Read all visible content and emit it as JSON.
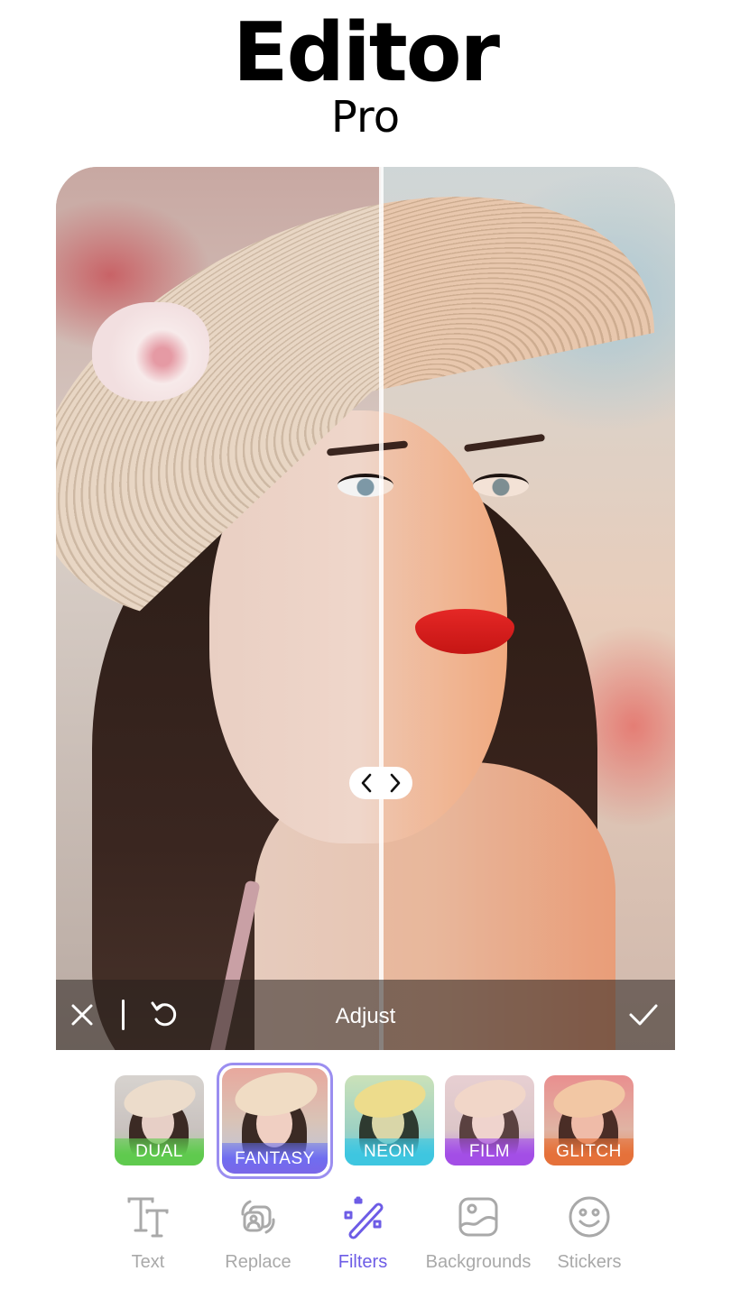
{
  "header": {
    "title": "Editor",
    "subtitle": "Pro"
  },
  "editor": {
    "compare_handle": {
      "left_icon": "chevron-left-icon",
      "right_icon": "chevron-right-icon"
    },
    "toolbar": {
      "title": "Adjust",
      "close_icon": "close-icon",
      "undo_icon": "undo-icon",
      "apply_icon": "checkmark-icon"
    }
  },
  "filters": {
    "selected": "FANTASY",
    "items": [
      {
        "label": "DUAL",
        "color": "#5fca4e"
      },
      {
        "label": "FANTASY",
        "color": "#6f6df0"
      },
      {
        "label": "NEON",
        "color": "#3ec6e0"
      },
      {
        "label": "FILM",
        "color": "#a34ee6"
      },
      {
        "label": "GLITCH",
        "color": "#e5713a"
      }
    ],
    "selected_ring_color": "#9b8ef0"
  },
  "tools": {
    "active": "Filters",
    "active_color": "#6d5ce6",
    "inactive_color": "#a9a9a9",
    "items": [
      {
        "label": "Text",
        "icon": "text-icon"
      },
      {
        "label": "Replace",
        "icon": "replace-icon"
      },
      {
        "label": "Filters",
        "icon": "magic-wand-icon"
      },
      {
        "label": "Backgrounds",
        "icon": "image-icon"
      },
      {
        "label": "Stickers",
        "icon": "smiley-icon"
      }
    ]
  }
}
